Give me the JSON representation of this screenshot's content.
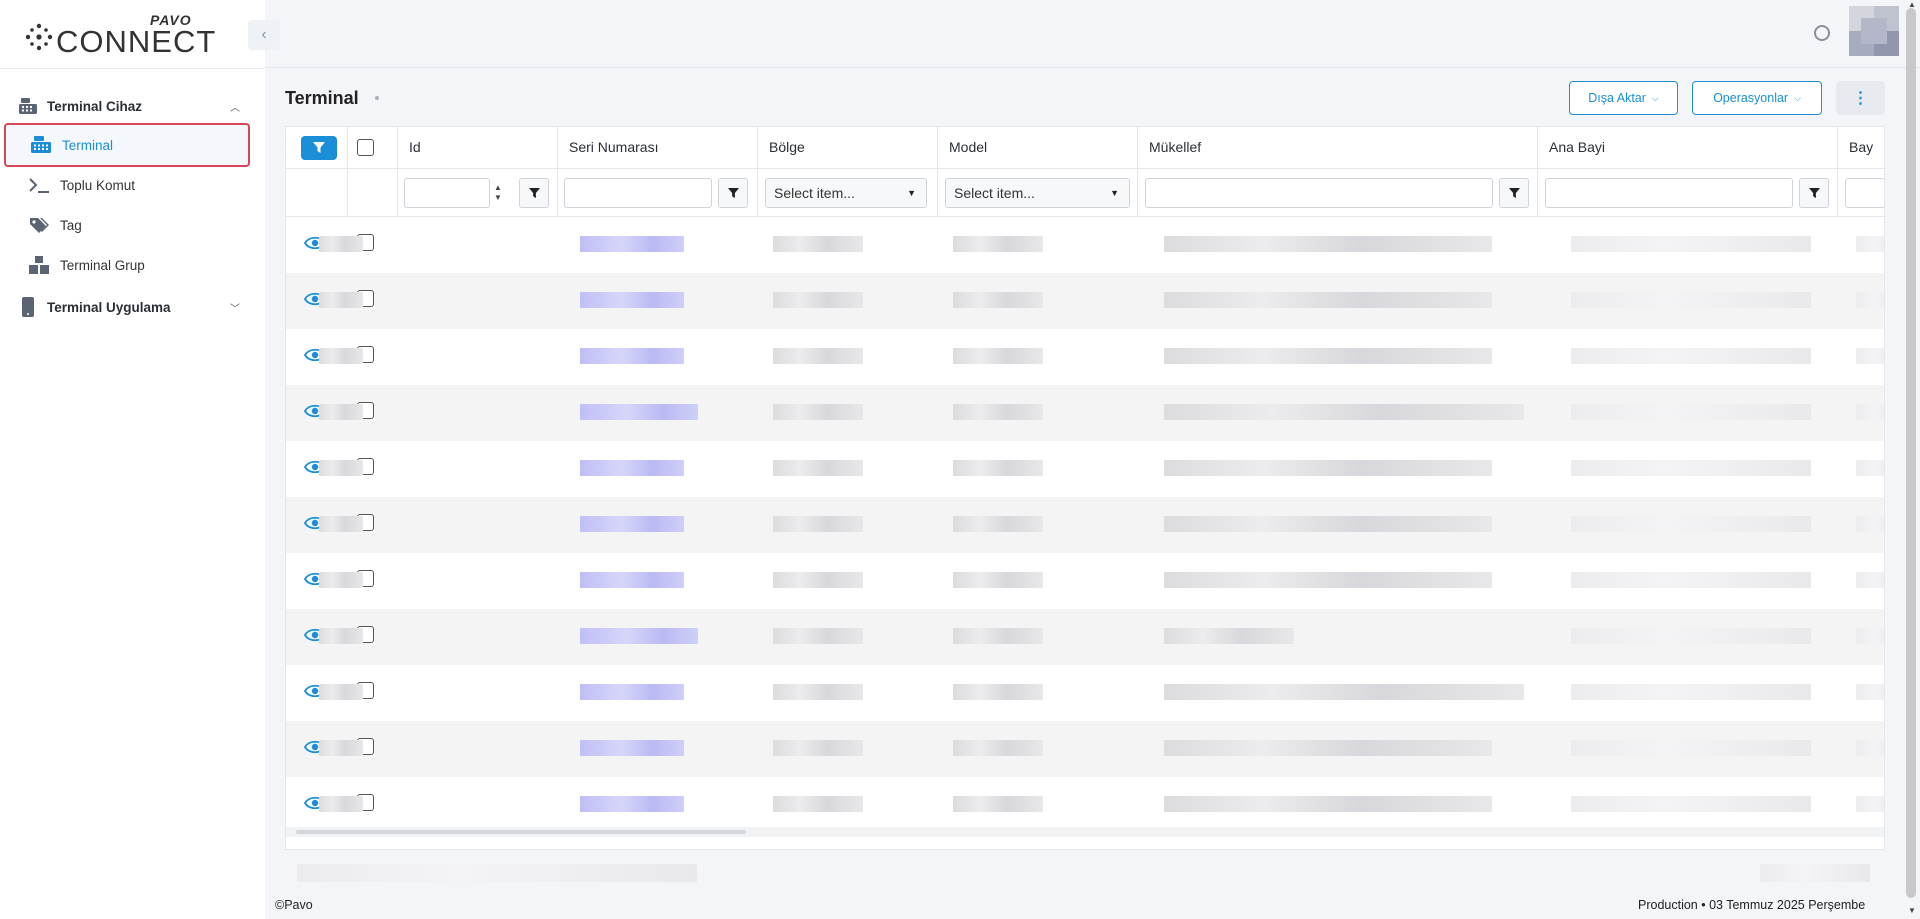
{
  "brand": {
    "name": "CONNECT",
    "sub": "PAVO",
    "accent": "#1a8fd8",
    "highlight_border": "#d9465a"
  },
  "sidebar": {
    "groups": [
      {
        "label": "Terminal Cihaz",
        "icon": "cash-register-icon",
        "expanded": true
      },
      {
        "label": "Terminal Uygulama",
        "icon": "mobile-device-icon",
        "expanded": false
      }
    ],
    "items": [
      {
        "label": "Terminal",
        "icon": "cash-register-icon",
        "active": true
      },
      {
        "label": "Toplu Komut",
        "icon": "terminal-prompt-icon",
        "active": false
      },
      {
        "label": "Tag",
        "icon": "tags-icon",
        "active": false
      },
      {
        "label": "Terminal Grup",
        "icon": "boxes-icon",
        "active": false
      }
    ]
  },
  "page": {
    "title": "Terminal",
    "export_label": "Dışa Aktar",
    "operations_label": "Operasyonlar"
  },
  "grid": {
    "columns": [
      "Id",
      "Seri Numarası",
      "Bölge",
      "Model",
      "Mükellef",
      "Ana Bayi",
      "Bay"
    ],
    "select_placeholder": "Select item...",
    "row_count": 11
  },
  "footer": {
    "copyright": "©Pavo",
    "status": "Production • 03 Temmuz 2025 Perşembe"
  }
}
